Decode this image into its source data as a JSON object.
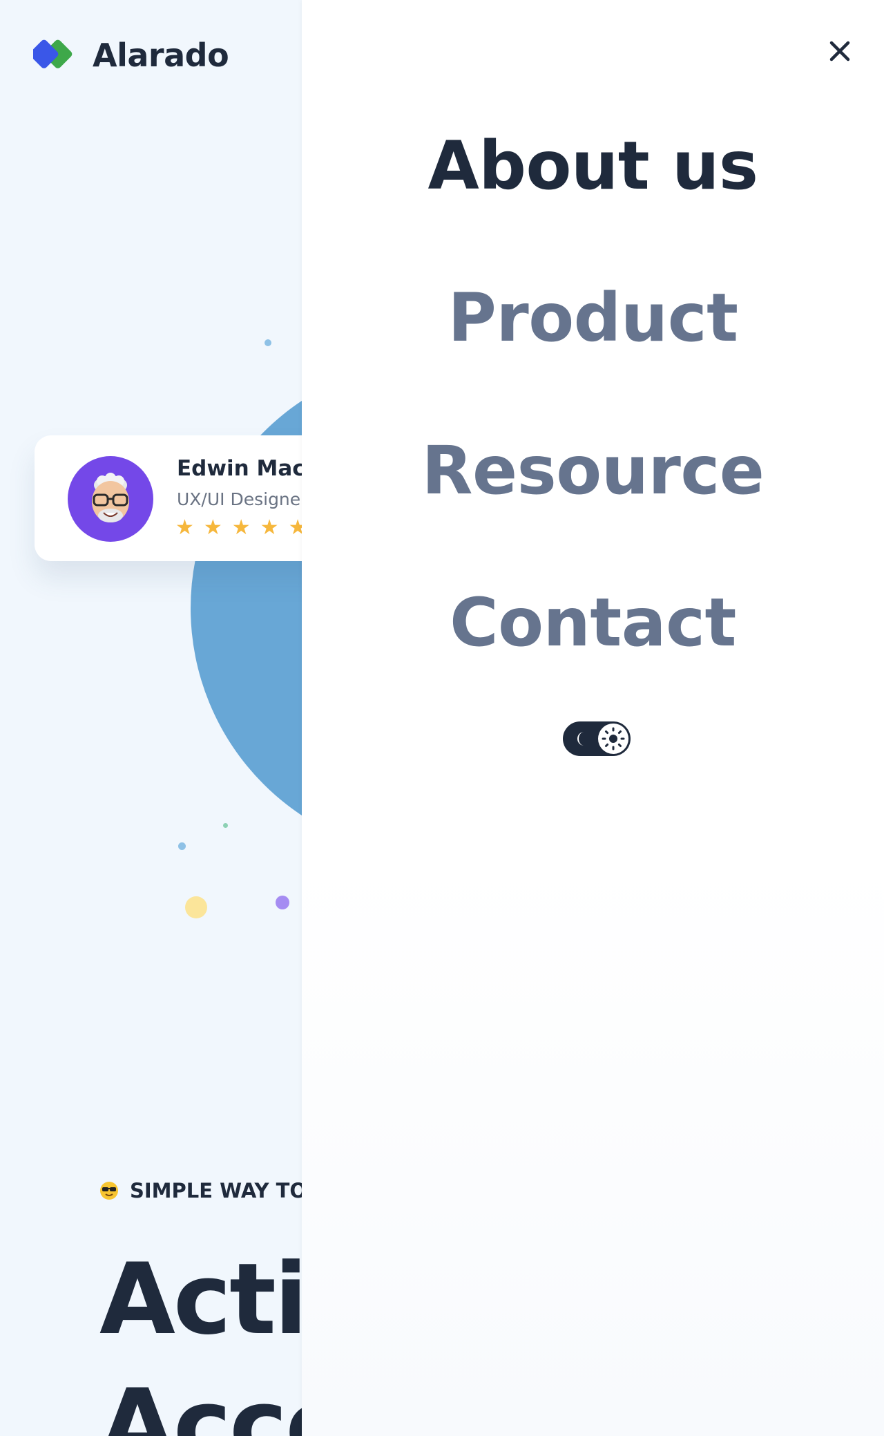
{
  "brand": {
    "name": "Alarado",
    "colors": {
      "mark_blue": "#3a57e8",
      "mark_green": "#3ea84a"
    }
  },
  "profile_card": {
    "name": "Edwin Mack",
    "role": "UX/UI Designer",
    "stars": "★★★★★",
    "rating": 5
  },
  "hero": {
    "tagline": "SIMPLE WAY TO CO",
    "tag_icon": "sunglasses-emoji-icon",
    "title_line1": "Actic",
    "title_line2": "Acce"
  },
  "menu": {
    "close_icon": "close-icon",
    "items": [
      {
        "label": "About us",
        "active": true
      },
      {
        "label": "Product",
        "active": false
      },
      {
        "label": "Resource",
        "active": false
      },
      {
        "label": "Contact",
        "active": false
      }
    ],
    "theme_toggle": {
      "moon_icon": "moon-icon",
      "sun_icon": "sun-icon",
      "state": "light"
    }
  },
  "colors": {
    "page_bg": "#f1f7fd",
    "panel_bg": "#ffffff",
    "text_dark": "#1f2a3c",
    "text_muted": "#66748e",
    "circle_blue": "#68a7d6",
    "avatar_purple": "#7448e8",
    "star_yellow": "#f6b73c"
  }
}
